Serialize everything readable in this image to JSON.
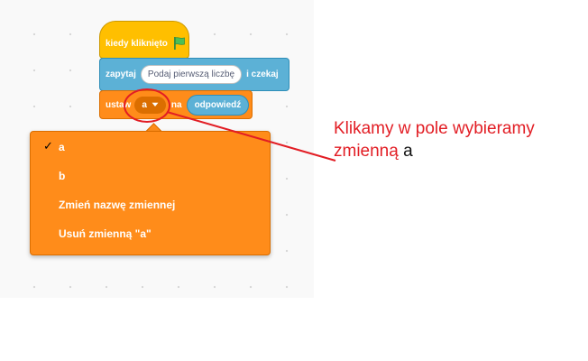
{
  "blocks": {
    "when_flag_clicked": {
      "label": "kiedy kliknięto",
      "icon": "green-flag-icon"
    },
    "ask_and_wait": {
      "label_ask": "zapytaj",
      "input_value": "Podaj pierwszą liczbę",
      "label_wait": "i czekaj"
    },
    "set_variable": {
      "label_set": "ustaw",
      "variable_selected": "a",
      "label_to": "na",
      "reporter": "odpowiedź"
    }
  },
  "dropdown_menu": {
    "checkmark": "✓",
    "items": [
      {
        "label": "a",
        "checked": true
      },
      {
        "label": "b",
        "checked": false
      },
      {
        "label": "Zmień nazwę zmiennej",
        "checked": false
      },
      {
        "label": "Usuń zmienną \"a\"",
        "checked": false
      }
    ]
  },
  "annotation": {
    "text_red": "Klikamy w pole wybieramy zmienną",
    "text_black": "a"
  },
  "colors": {
    "events": "#ffbf00",
    "sensing": "#5cb1d6",
    "variables": "#ff8c1a",
    "variables_dark": "#db6e00",
    "annotation": "#e21d24",
    "flag": "#4cbf56"
  }
}
